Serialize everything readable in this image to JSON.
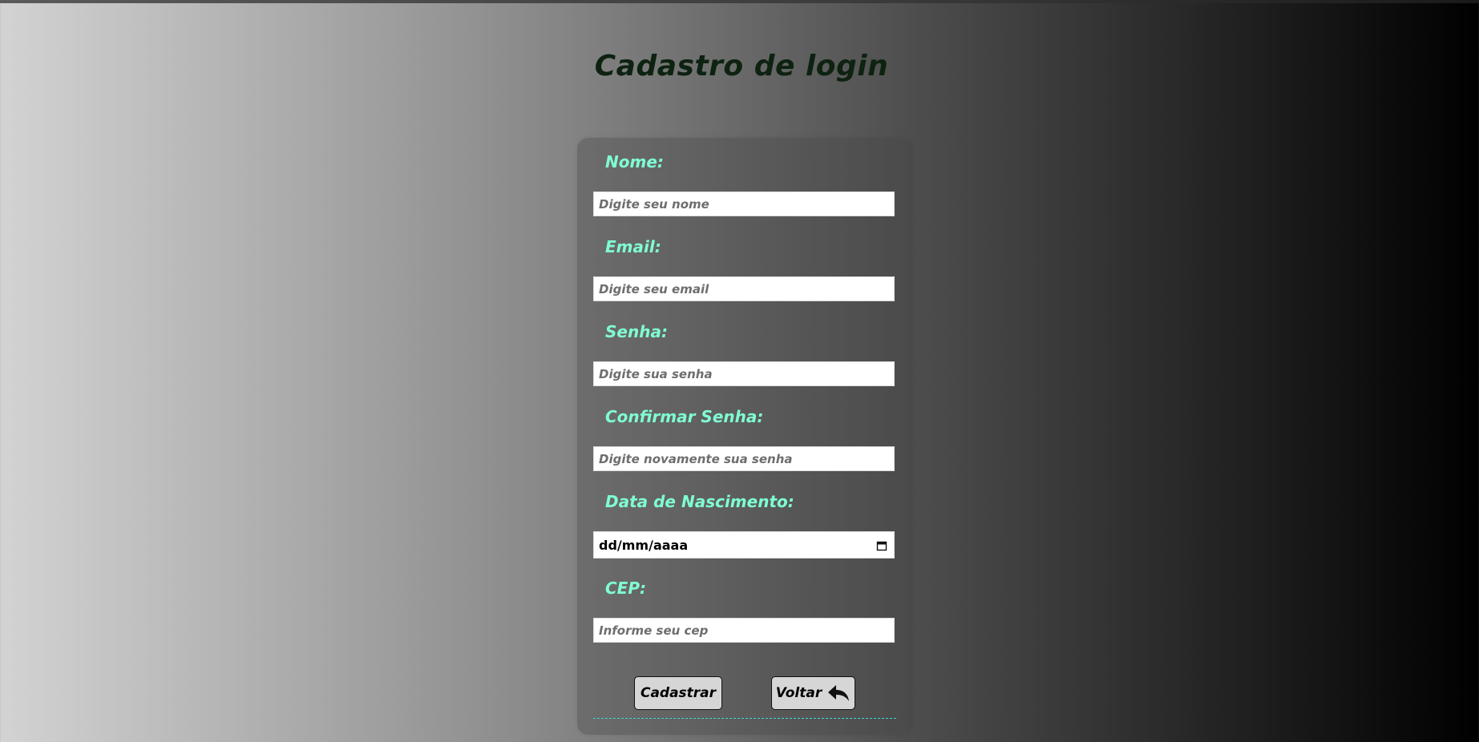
{
  "title": "Cadastro de login",
  "fields": [
    {
      "label": "Nome:",
      "placeholder": "Digite seu nome"
    },
    {
      "label": "Email:",
      "placeholder": "Digite seu email"
    },
    {
      "label": "Senha:",
      "placeholder": "Digite sua senha"
    },
    {
      "label": "Confirmar Senha:",
      "placeholder": "Digite novamente sua senha"
    },
    {
      "label": "Data de Nascimento:",
      "value": "dd/mm/aaaa"
    },
    {
      "label": "CEP:",
      "placeholder": "Informe seu cep"
    }
  ],
  "buttons": {
    "register": "Cadastrar",
    "back": "Voltar"
  },
  "icons": {
    "back": "reply-arrow-icon",
    "calendar": "calendar-icon"
  },
  "colors": {
    "label": "#7fffd4",
    "title": "#0d2210",
    "divider": "#3fd6d6"
  }
}
